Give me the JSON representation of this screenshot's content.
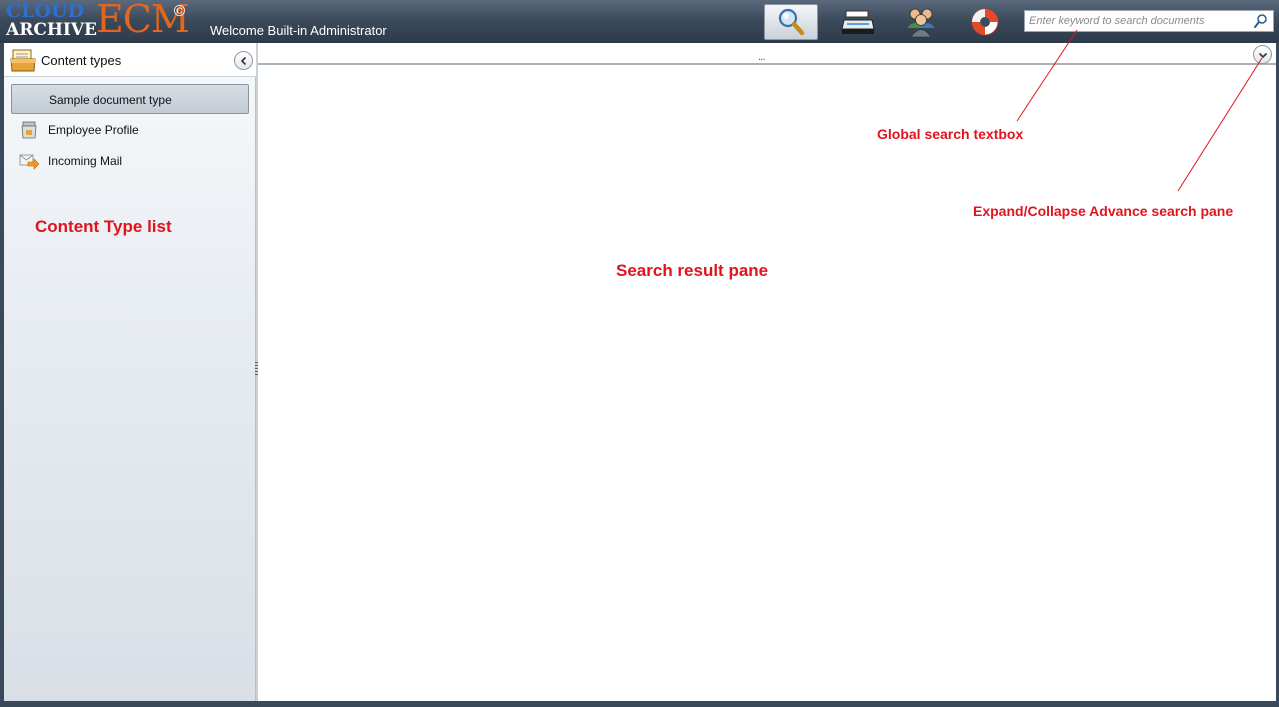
{
  "header": {
    "logo": {
      "cloud": "CLOUD",
      "archive": "ARCHIVE",
      "ecm": "ECM",
      "copyright": "©"
    },
    "welcome": "Welcome Built-in Administrator",
    "toolbar": [
      {
        "icon": "search-icon",
        "active": true
      },
      {
        "icon": "scanner-icon",
        "active": false
      },
      {
        "icon": "users-icon",
        "active": false
      },
      {
        "icon": "lifebuoy-icon",
        "active": false
      }
    ],
    "search": {
      "placeholder": "Enter keyword to search documents",
      "value": ""
    }
  },
  "sidebar": {
    "title": "Content types",
    "items": [
      {
        "label": "Sample document type",
        "icon": "",
        "selected": true
      },
      {
        "label": "Employee Profile",
        "icon": "employee-profile-icon",
        "selected": false
      },
      {
        "label": "Incoming Mail",
        "icon": "incoming-mail-icon",
        "selected": false
      }
    ]
  },
  "annotations": {
    "global_search": "Global search textbox",
    "expand_collapse": "Expand/Collapse Advance search pane",
    "content_type_list": "Content Type list",
    "search_result": "Search result pane"
  },
  "colors": {
    "annotation": "#e0141e",
    "header_dark": "#2c3a4a",
    "logo_blue": "#2f6fd0",
    "logo_orange": "#e2661c"
  }
}
